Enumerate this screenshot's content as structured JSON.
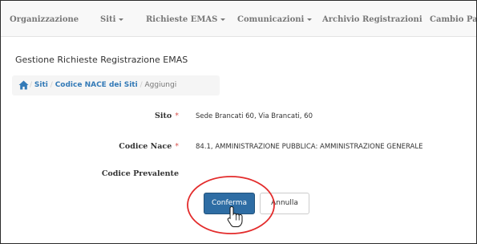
{
  "nav": {
    "items": [
      {
        "label": "Organizzazione"
      },
      {
        "label": "Siti"
      },
      {
        "label": "Richieste EMAS"
      },
      {
        "label": "Comunicazioni"
      },
      {
        "label": "Archivio Registrazioni"
      },
      {
        "label": "Cambio Pa"
      }
    ]
  },
  "page": {
    "title": "Gestione Richieste Registrazione EMAS"
  },
  "breadcrumb": {
    "separator": "/",
    "items": [
      {
        "label": "Siti"
      },
      {
        "label": "Codice NACE dei Siti"
      },
      {
        "label": "Aggiungi"
      }
    ]
  },
  "form": {
    "required_marker": "*",
    "fields": [
      {
        "label": "Sito",
        "value": "Sede Brancati 60, Via Brancati, 60"
      },
      {
        "label": "Codice Nace",
        "value": "84.1, AMMINISTRAZIONE PUBBLICA: AMMINISTRAZIONE GENERALE"
      },
      {
        "label": "Codice Prevalente",
        "value": ""
      }
    ]
  },
  "buttons": {
    "confirm": "Conferma",
    "cancel": "Annulla"
  },
  "colors": {
    "primary": "#2e6da4",
    "link": "#337ab7",
    "required": "#d9534f",
    "annotation": "#e32b2b"
  }
}
